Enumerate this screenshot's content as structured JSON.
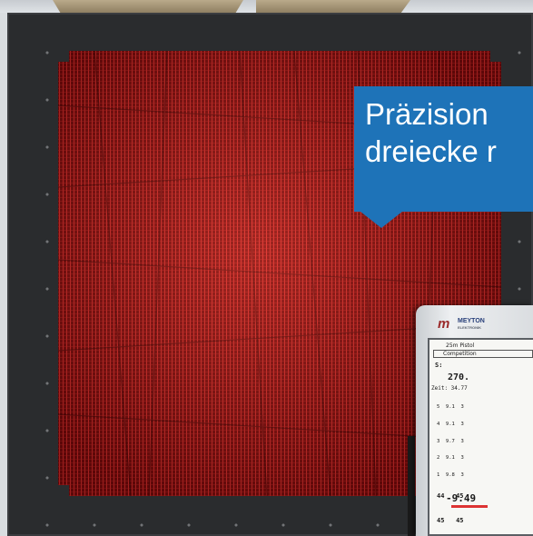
{
  "callout": {
    "line1": "Präzision",
    "line2": "dreiecke r"
  },
  "device": {
    "brand": "MEYTON",
    "brand_sub": "ELEKTRONIK",
    "screen": {
      "title": "25m Pistol",
      "mode": "Competition",
      "s_label": "S:",
      "score": "270.",
      "zeit": "Zeit: 34.77",
      "shots": [
        "5  9.1  3",
        "4  9.1  3",
        "3  9.7  3",
        "2  9.1  3",
        "1  9.8  3"
      ],
      "bottom_row1": "44   45",
      "bottom_row2": "45   45",
      "final": "-9.49"
    }
  },
  "colors": {
    "frame": "#2a2c2e",
    "target": "#7a0f10",
    "callout": "#1e73b8"
  }
}
